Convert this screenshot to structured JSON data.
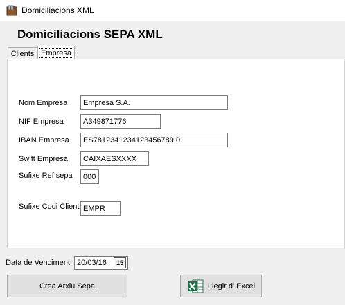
{
  "window": {
    "title": "Domiciliacions XML"
  },
  "heading": "Domiciliacions SEPA XML",
  "tabs": [
    {
      "label": "Clients",
      "active": false
    },
    {
      "label": "Empresa",
      "active": true
    }
  ],
  "form": {
    "nom_empresa": {
      "label": "Nom Empresa",
      "value": "Empresa S.A."
    },
    "nif_empresa": {
      "label": "NIF Empresa",
      "value": "A349871776"
    },
    "iban_empresa": {
      "label": "IBAN Empresa",
      "value": "ES7812341234123456789 0"
    },
    "swift_empresa": {
      "label": "Swift Empresa",
      "value": "CAIXAESXXXX"
    },
    "sufixe_ref_sepa": {
      "label": "Sufixe Ref sepa",
      "value": "000"
    },
    "sufixe_codi_client": {
      "label": "Sufixe Codi Client",
      "value": "EMPR"
    }
  },
  "venciment": {
    "label": "Data de Venciment",
    "value": "20/03/16",
    "calendar_icon_text": "15"
  },
  "buttons": {
    "crea": "Crea Arxiu Sepa",
    "excel": "Llegir d' Excel"
  },
  "icons": {
    "app": "app-icon",
    "calendar": "calendar-icon",
    "excel": "excel-icon"
  }
}
